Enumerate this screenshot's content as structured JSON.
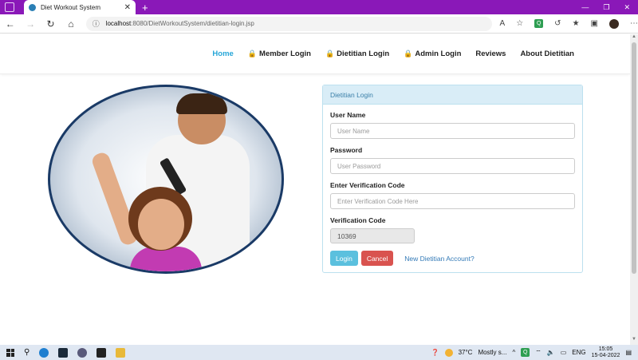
{
  "browser": {
    "tab_title": "Diet Workout System",
    "url_host": "localhost",
    "url_path": ":8080/DietWorkoutSystem/dietitian-login.jsp",
    "new_tab": "+",
    "close": "✕"
  },
  "navbar": {
    "items": [
      {
        "label": "Home",
        "active": true,
        "lock": false
      },
      {
        "label": "Member Login",
        "active": false,
        "lock": true
      },
      {
        "label": "Dietitian Login",
        "active": false,
        "lock": true
      },
      {
        "label": "Admin Login",
        "active": false,
        "lock": true
      },
      {
        "label": "Reviews",
        "active": false,
        "lock": false
      },
      {
        "label": "About Dietitian",
        "active": false,
        "lock": false
      }
    ]
  },
  "login": {
    "heading": "Dietitian Login",
    "username_label": "User Name",
    "username_placeholder": "User Name",
    "password_label": "Password",
    "password_placeholder": "User Password",
    "verify_label": "Enter Verification Code",
    "verify_placeholder": "Enter Verification Code Here",
    "code_label": "Verification Code",
    "code_value": "10369",
    "login_button": "Login",
    "cancel_button": "Cancel",
    "new_account_link": "New Dietitian Account?"
  },
  "taskbar": {
    "weather": "37°C",
    "weather_desc": "Mostly s...",
    "language": "ENG",
    "time": "15:05",
    "date": "15-04-2022"
  },
  "colors": {
    "accent": "#26a6d8",
    "titlebar": "#8a18b8",
    "panel_heading": "#d9edf7",
    "login_btn": "#5bc0de",
    "cancel_btn": "#d9534f"
  }
}
